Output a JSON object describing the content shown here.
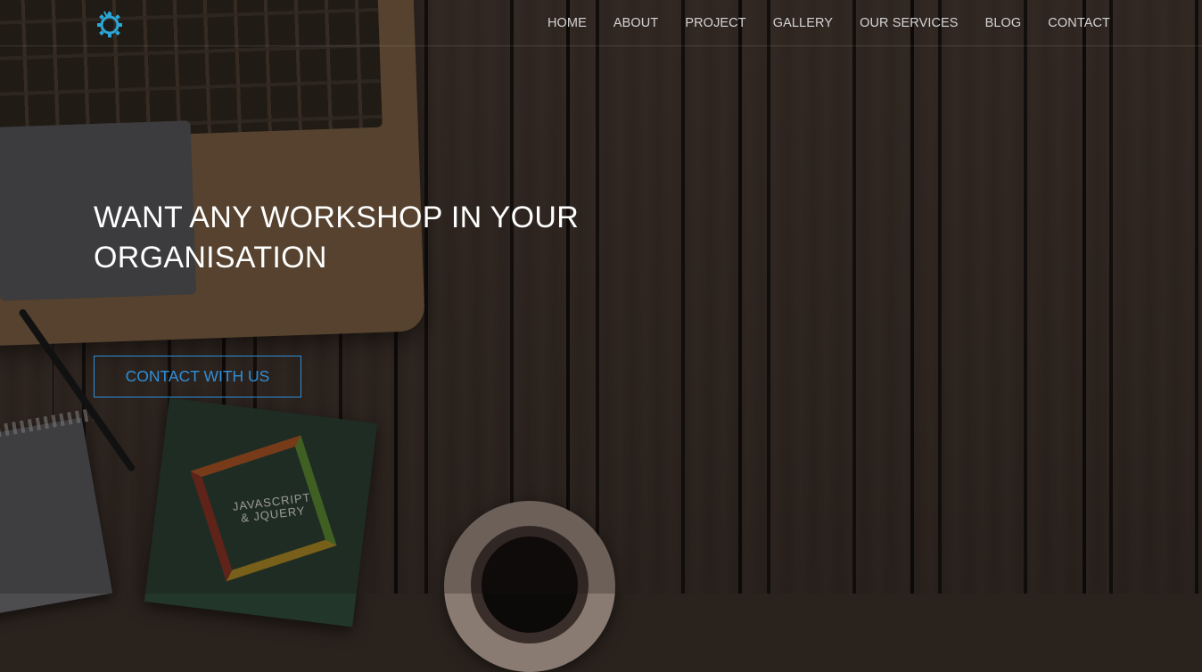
{
  "header": {
    "logo_icon": "gear-logo-icon",
    "nav": [
      {
        "label": "HOME"
      },
      {
        "label": "ABOUT"
      },
      {
        "label": "PROJECT"
      },
      {
        "label": "GALLERY"
      },
      {
        "label": "OUR SERVICES"
      },
      {
        "label": "BLOG"
      },
      {
        "label": "CONTACT"
      }
    ]
  },
  "hero": {
    "heading_line1": "WANT ANY WORKSHOP IN YOUR",
    "heading_line2": "ORGANISATION",
    "cta_label": "CONTACT WITH US"
  },
  "decor": {
    "book_title_line1": "JAVASCRIPT",
    "book_title_line2": "& JQUERY"
  },
  "colors": {
    "accent": "#2f8fd8",
    "logo": "#2aa7d6",
    "nav_text": "#d4d4d4",
    "heading_text": "#ffffff"
  }
}
